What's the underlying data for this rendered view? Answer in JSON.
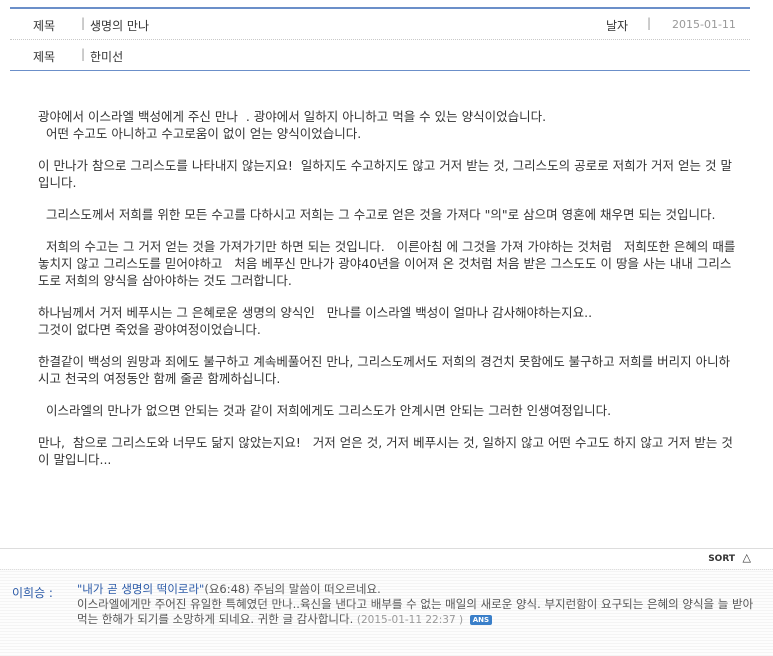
{
  "header": {
    "title_label": "제목",
    "title_value": "생명의 만나",
    "date_label": "날자",
    "date_value": "2015-01-11",
    "author_label": "제목",
    "author_value": "한미선",
    "separator": "|"
  },
  "content": {
    "paragraphs": [
      "광야에서 이스라엘 백성에게 주신 만나  . 광야에서 일하지 아니하고 먹을 수 있는 양식이었습니다.\n  어떤 수고도 아니하고 수고로움이 없이 얻는 양식이었습니다.",
      "이 만나가 참으로 그리스도를 나타내지 않는지요!  일하지도 수고하지도 않고 거저 받는 것, 그리스도의 공로로 저희가 거저 얻는 것 말입니다.",
      "  그리스도께서 저희를 위한 모든 수고를 다하시고 저희는 그 수고로 얻은 것을 가져다 \"의\"로 삼으며 영혼에 채우면 되는 것입니다.",
      "  저희의 수고는 그 거저 얻는 것을 가져가기만 하면 되는 것입니다.   이른아침 에 그것을 가져 가야하는 것처럼   저희또한 은혜의 때를 놓치지 않고 그리스도를 믿어야하고   처음 베푸신 만나가 광야40년을 이어져 온 것처럼 처음 받은 그스도도 이 땅을 사는 내내 그리스도로 저희의 양식을 삼아야하는 것도 그러합니다.",
      "하나님께서 거저 베푸시는 그 은혜로운 생명의 양식인   만나를 이스라엘 백성이 얼마나 감사해야하는지요..\n그것이 없다면 죽었을 광야여정이었습니다.",
      "한결같이 백성의 원망과 죄에도 불구하고 계속베풀어진 만나, 그리스도께서도 저희의 경건치 못함에도 불구하고 저희를 버리지 아니하시고 천국의 여정동안 함께 줄곧 함께하십니다.",
      "  이스라엘의 만나가 없으면 안되는 것과 같이 저희에게도 그리스도가 안계시면 안되는 그러한 인생여정입니다.",
      "만나,  참으로 그리스도와 너무도 닮지 않았는지요!   거저 얻은 것, 거저 베푸시는 것, 일하지 않고 어떤 수고도 하지 않고 거저 받는 것이 말입니다..."
    ]
  },
  "sort": {
    "label": "SORT",
    "icon": "triangle-up-icon"
  },
  "comment": {
    "author": "이희승 :",
    "quote": "\"내가 곧 생명의 떡이로라\"",
    "text_after_quote": "(요6:48) 주님의 말씀이 떠오르네요.",
    "text_rest": "이스라엘에게만 주어진 유일한 특혜였던 만나..육신을 낸다고 배부를 수 없는 매일의 새로운 양식. 부지런함이 요구되는 은혜의 양식을 늘 받아먹는 한해가 되기를 소망하게 되네요. 귀한 글 감사합니다.",
    "date": "(2015-01-11 22:37  )",
    "answer_badge": "ANS"
  },
  "colors": {
    "accent_line": "#6b8fc9",
    "comment_author": "#2b5aa8",
    "answer_badge_bg": "#3a7fc9"
  }
}
